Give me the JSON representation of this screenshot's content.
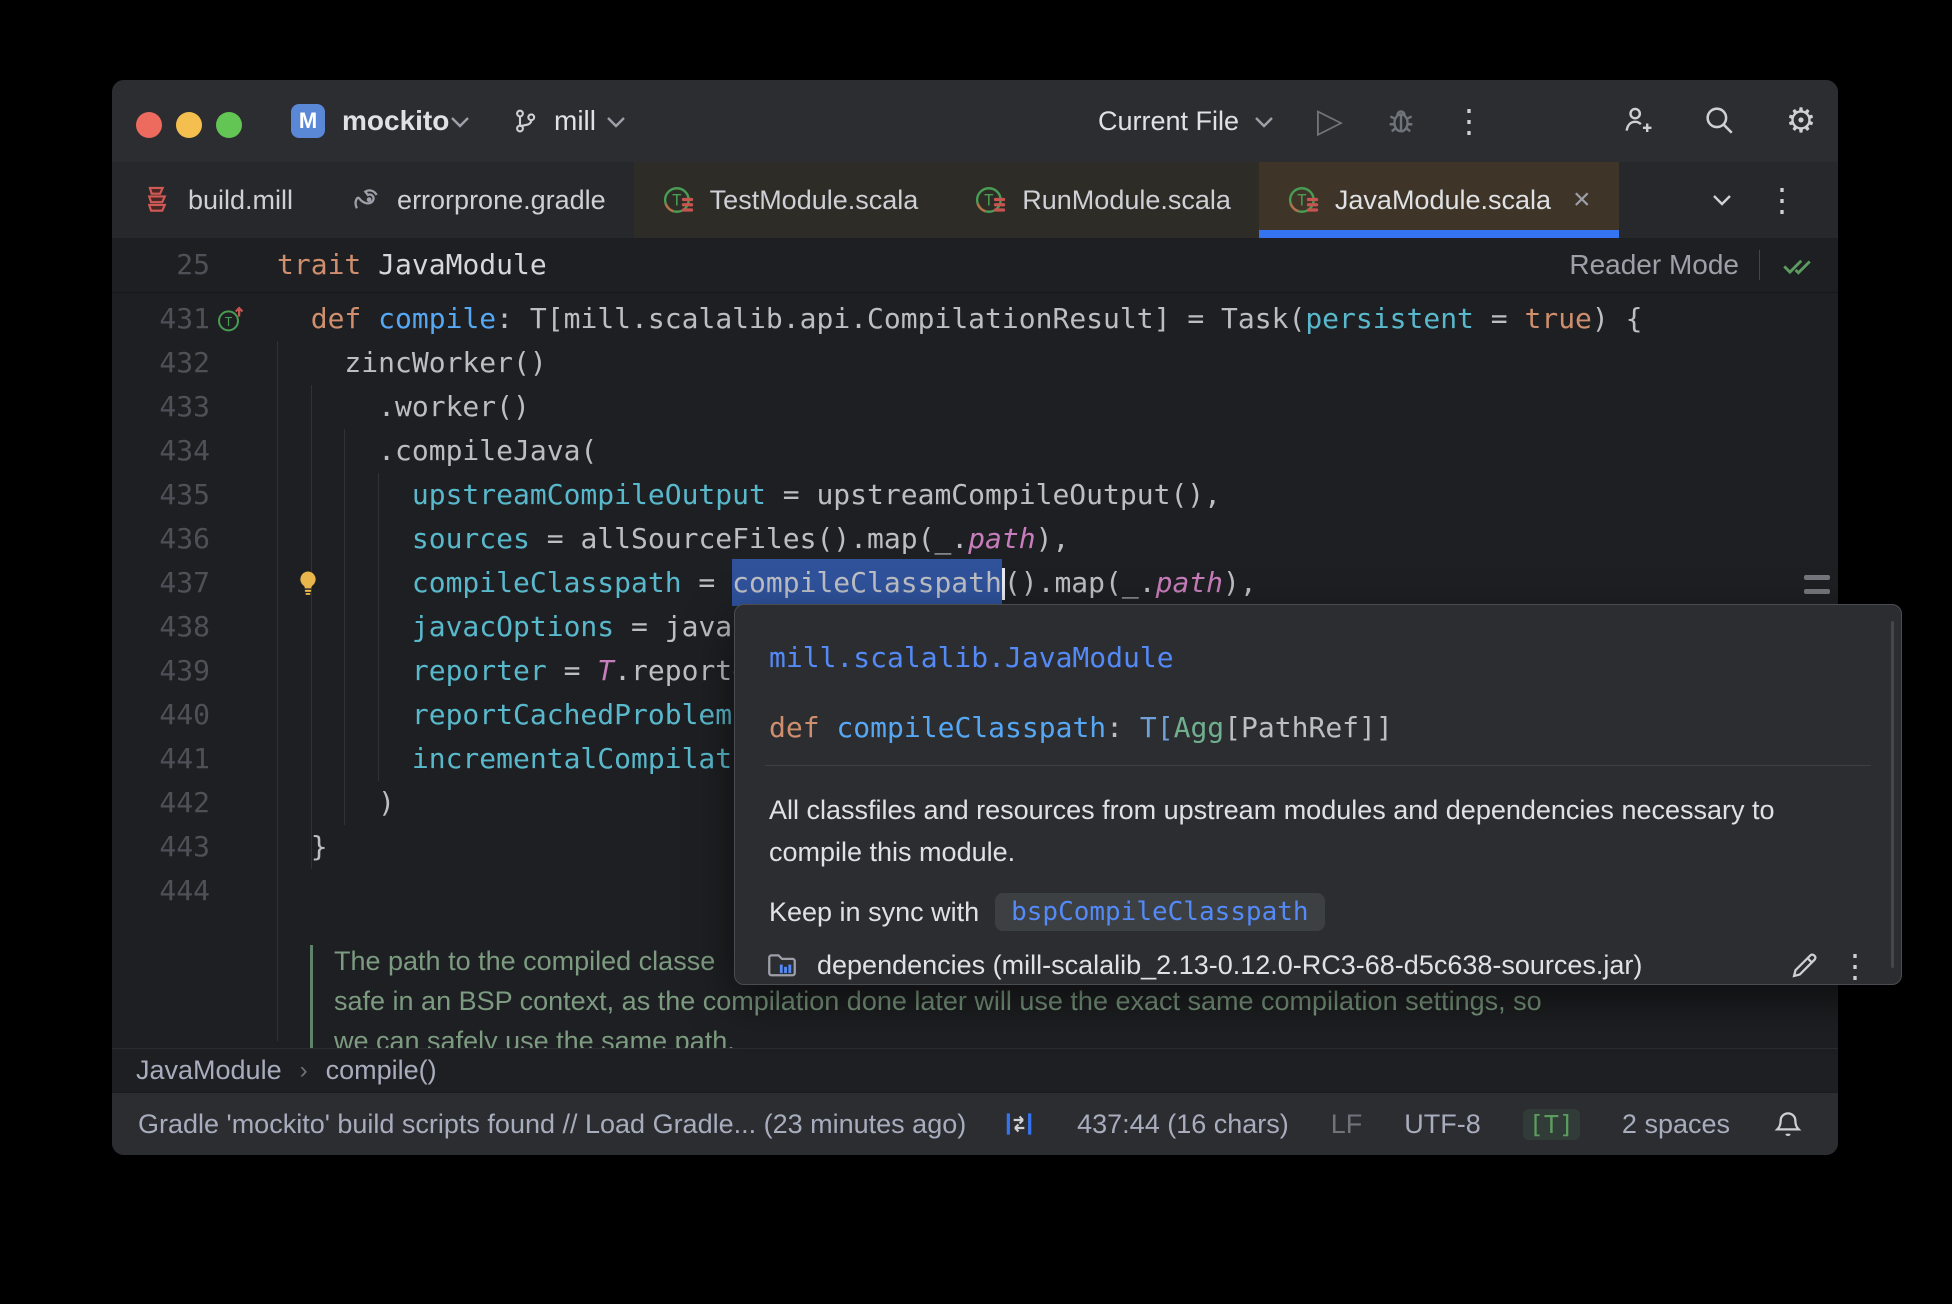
{
  "titlebar": {
    "project_badge": "M",
    "project_name": "mockito",
    "branch_name": "mill",
    "run_config": "Current File",
    "play_glyph": "▷",
    "dots_glyph": "⋮",
    "gear_glyph": "⚙"
  },
  "tabbar": {
    "tabs": [
      {
        "label": "build.mill"
      },
      {
        "label": "errorprone.gradle"
      },
      {
        "label": "TestModule.scala"
      },
      {
        "label": "RunModule.scala"
      },
      {
        "label": "JavaModule.scala",
        "close": "×"
      }
    ],
    "dots_glyph": "⋮"
  },
  "sticky": {
    "line_number": "25",
    "keyword": "trait",
    "name": " JavaModule",
    "reader_mode": "Reader Mode"
  },
  "editor": {
    "lines": [
      {
        "num": "431",
        "tokens": [
          [
            "p",
            "  "
          ],
          [
            "kw",
            "def"
          ],
          [
            "p",
            " "
          ],
          [
            "fn",
            "compile"
          ],
          [
            "p",
            ": T[mill.scalalib.api.CompilationResult] = Task("
          ],
          [
            "prm",
            "persistent"
          ],
          [
            "p",
            " = "
          ],
          [
            "kw",
            "true"
          ],
          [
            "p",
            ") {"
          ]
        ]
      },
      {
        "num": "432",
        "tokens": [
          [
            "p",
            "    zincWorker()"
          ]
        ]
      },
      {
        "num": "433",
        "tokens": [
          [
            "p",
            "      .worker()"
          ]
        ]
      },
      {
        "num": "434",
        "tokens": [
          [
            "p",
            "      .compileJava("
          ]
        ]
      },
      {
        "num": "435",
        "tokens": [
          [
            "p",
            "        "
          ],
          [
            "prm",
            "upstreamCompileOutput"
          ],
          [
            "p",
            " = upstreamCompileOutput(),"
          ]
        ]
      },
      {
        "num": "436",
        "tokens": [
          [
            "p",
            "        "
          ],
          [
            "prm",
            "sources"
          ],
          [
            "p",
            " = allSourceFiles().map(_."
          ],
          [
            "fld",
            "path"
          ],
          [
            "p",
            "),"
          ]
        ]
      },
      {
        "num": "437",
        "tokens": [
          [
            "p",
            "        "
          ],
          [
            "prm",
            "compileClasspath"
          ],
          [
            "p",
            " = "
          ],
          [
            "sel",
            "compileClasspath"
          ],
          [
            "caret",
            ""
          ],
          [
            "p",
            "().map(_."
          ],
          [
            "fld",
            "path"
          ],
          [
            "p",
            "),"
          ]
        ]
      },
      {
        "num": "438",
        "tokens": [
          [
            "p",
            "        "
          ],
          [
            "prm",
            "javacOptions"
          ],
          [
            "p",
            " = javacO"
          ]
        ]
      },
      {
        "num": "439",
        "tokens": [
          [
            "p",
            "        "
          ],
          [
            "prm",
            "reporter"
          ],
          [
            "p",
            " = "
          ],
          [
            "fld",
            "T"
          ],
          [
            "p",
            ".reporter"
          ]
        ]
      },
      {
        "num": "440",
        "tokens": [
          [
            "p",
            "        "
          ],
          [
            "prm",
            "reportCachedProblems"
          ]
        ]
      },
      {
        "num": "441",
        "tokens": [
          [
            "p",
            "        "
          ],
          [
            "prm",
            "incrementalCompilatio"
          ]
        ]
      },
      {
        "num": "442",
        "tokens": [
          [
            "p",
            "      )"
          ]
        ]
      },
      {
        "num": "443",
        "tokens": [
          [
            "p",
            "  }"
          ]
        ]
      },
      {
        "num": "444",
        "tokens": []
      }
    ],
    "comment": [
      "The path to the compiled classe",
      "safe in an BSP context, as the compilation done later will use the exact same compilation settings, so",
      "we can safely use the same path."
    ]
  },
  "popup": {
    "link": "mill.scalalib.JavaModule",
    "signature": {
      "kw": "def ",
      "name": "compileClasspath",
      "colon": ": ",
      "t": "T[",
      "agg": "Agg",
      "rest": "[PathRef]]"
    },
    "description": [
      "All classfiles and resources from upstream modules and dependencies necessary to",
      "compile this module."
    ],
    "keep_in_sync": "Keep in sync with",
    "chip": "bspCompileClasspath",
    "footer": "dependencies (mill-scalalib_2.13-0.12.0-RC3-68-d5c638-sources.jar)",
    "dots_glyph": "⋮"
  },
  "breadcrumbs": {
    "items": [
      "JavaModule",
      "compile()"
    ],
    "separator": "›"
  },
  "statusbar": {
    "message": "Gradle 'mockito' build scripts found // Load Gradle... (23 minutes ago)",
    "position": "437:44 (16 chars)",
    "line_ending": "LF",
    "encoding": "UTF-8",
    "type_badge": "[T]",
    "indent": "2 spaces"
  },
  "colors": {
    "accent_blue": "#3574F0",
    "link_blue": "#548AF7",
    "selection_blue": "#2F529B",
    "keyword_orange": "#CF8E6D",
    "param_teal": "#59B9CC",
    "field_purple": "#C77DBB",
    "comment_green": "#7C9B80",
    "editor_bg": "#1E1F22",
    "panel_bg": "#2B2D31",
    "active_tab_bg": "#3E3528"
  }
}
